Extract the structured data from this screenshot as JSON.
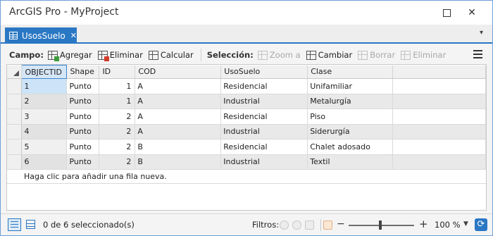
{
  "window": {
    "title": "ArcGIS Pro - MyProject"
  },
  "tab": {
    "label": "UsosSuelo"
  },
  "toolbar": {
    "campo_label": "Campo:",
    "agregar": "Agregar",
    "eliminar": "Eliminar",
    "calcular": "Calcular",
    "seleccion_label": "Selección:",
    "zoom": "Zoom a",
    "cambiar": "Cambiar",
    "borrar": "Borrar",
    "eliminar_sel": "Eliminar"
  },
  "table": {
    "columns": [
      "OBJECTID",
      "Shape",
      "ID",
      "COD",
      "UsoSuelo",
      "Clase"
    ],
    "rows": [
      [
        "1",
        "Punto",
        "1",
        "A",
        "Residencial",
        "Unifamiliar"
      ],
      [
        "2",
        "Punto",
        "1",
        "A",
        "Industrial",
        "Metalurgía"
      ],
      [
        "3",
        "Punto",
        "2",
        "A",
        "Residencial",
        "Piso"
      ],
      [
        "4",
        "Punto",
        "2",
        "A",
        "Industrial",
        "Siderurgía"
      ],
      [
        "5",
        "Punto",
        "2",
        "B",
        "Residencial",
        "Chalet adosado"
      ],
      [
        "6",
        "Punto",
        "2",
        "B",
        "Industrial",
        "Textil"
      ]
    ],
    "new_row_text": "Haga clic para añadir una fila nueva."
  },
  "statusbar": {
    "selection": "0 de 6 seleccionado(s)",
    "filters_label": "Filtros:",
    "zoom_value": "100 %"
  },
  "colors": {
    "accent": "#2a77c4"
  }
}
